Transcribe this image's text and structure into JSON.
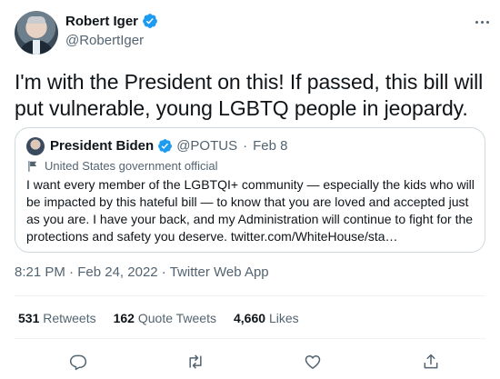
{
  "author": {
    "name": "Robert Iger",
    "handle": "@RobertIger"
  },
  "tweet": {
    "text": "I'm with the President on this! If passed, this bill will put vulnerable, young LGBTQ people in jeopardy."
  },
  "quote": {
    "name": "President Biden",
    "handle": "@POTUS",
    "separator": "·",
    "date": "Feb 8",
    "label": "United States government official",
    "text": "I want every member of the LGBTQI+ community — especially the kids who will be impacted by this hateful bill — to know that you are loved and accepted just as you are. I have your back, and my Administration will continue to fight for the protections and safety you deserve. twitter.com/WhiteHouse/sta…"
  },
  "meta": {
    "time": "8:21 PM",
    "sep1": " · ",
    "date": "Feb 24, 2022",
    "sep2": " · ",
    "source": "Twitter Web App"
  },
  "stats": {
    "retweets_count": "531",
    "retweets_label": "Retweets",
    "quotes_count": "162",
    "quotes_label": "Quote Tweets",
    "likes_count": "4,660",
    "likes_label": "Likes"
  },
  "icons": {
    "verified": "verified-badge-icon",
    "more": "more-icon",
    "flag": "flag-icon",
    "reply": "reply-icon",
    "retweet": "retweet-icon",
    "like": "heart-icon",
    "share": "share-icon"
  },
  "colors": {
    "verified": "#1d9bf0",
    "text": "#0f1419",
    "secondary": "#536471",
    "border": "#cfd9de"
  }
}
